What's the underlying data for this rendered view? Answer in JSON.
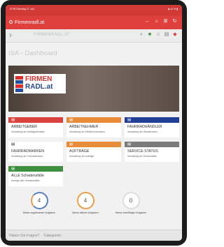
{
  "statusbar": {
    "time": "07:50  Dienstag 27. Juli",
    "battery": "◉ 41 % ▮"
  },
  "appbar": {
    "title": "Firmenradl.at",
    "actions": [
      {
        "name": "back-arrow-icon",
        "glyph": "←"
      },
      {
        "name": "home-icon",
        "glyph": "⌂"
      },
      {
        "name": "grid-icon",
        "glyph": "⊞"
      },
      {
        "name": "refresh-icon",
        "glyph": "↻"
      }
    ]
  },
  "navbar": {
    "url": "FIRMENRADL.AT",
    "icons": [
      {
        "name": "search-icon",
        "glyph": "⌕"
      },
      {
        "name": "extension-icon",
        "glyph": "■"
      },
      {
        "name": "star-icon",
        "glyph": "☆"
      },
      {
        "name": "reader-icon",
        "glyph": "▤"
      },
      {
        "name": "app-logo-icon",
        "glyph": "◆"
      }
    ]
  },
  "page": {
    "title": "ISA - Dashboard"
  },
  "hero": {
    "logo_line1": "FIRMEN",
    "logo_line2": "RADL.at"
  },
  "tiles": [
    {
      "name": "ARBEITGEBER",
      "sub": "Verwaltung der Arbeitgeberdaten",
      "color": "#d8433f",
      "icon": "▤"
    },
    {
      "name": "ARBEITNEHMER",
      "sub": "Verwaltung der Arbeitnehmerdaten",
      "color": "#e98c3a",
      "icon": "▤"
    },
    {
      "name": "FAHRRADHÄNDLER",
      "sub": "Verwaltung der Händlerdaten",
      "color": "#223f93",
      "icon": "▤"
    },
    {
      "name": "FAHRRADMARKEN",
      "sub": "Verwaltung der Fahrradmarken",
      "color": "#ffffff",
      "icon": "▤"
    },
    {
      "name": "AUFTRÄGE",
      "sub": "Verwaltung der Aufträge",
      "color": "#e98c3a",
      "icon": "▤"
    },
    {
      "name": "SERVICE STATUS",
      "sub": "Verwaltung der Servicedaten",
      "color": "#7b7b7b",
      "icon": "▤"
    },
    {
      "name": "ALLE Schadensfälle",
      "sub": "Anzeige aller Schadensfälle",
      "color": "#3e8f3e",
      "icon": "▤"
    }
  ],
  "counters": [
    {
      "value": "4",
      "label": "Meine ungelesenen Aufgaben"
    },
    {
      "value": "4",
      "label": "Meine aktiven Aufgaben"
    },
    {
      "value": "0",
      "label": "Meine überfälligen Aufgaben"
    }
  ],
  "bottombar": {
    "questions": "Haben Sie Fragen?",
    "categories": "Kategorien"
  }
}
